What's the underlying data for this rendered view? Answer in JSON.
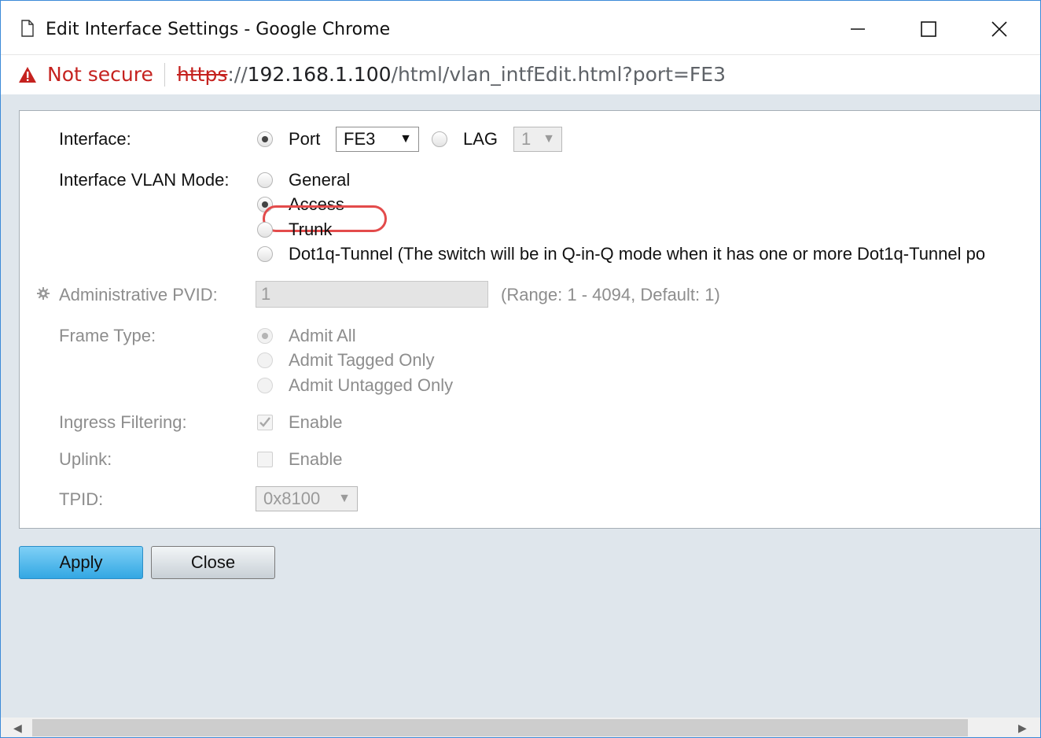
{
  "window": {
    "title": "Edit Interface Settings - Google Chrome",
    "icons": {
      "page": "page-icon",
      "minimize": "minimize-icon",
      "maximize": "maximize-icon",
      "close": "close-icon"
    }
  },
  "address": {
    "security_label": "Not secure",
    "url_scheme": "https",
    "url_sep": "://",
    "url_host": "192.168.1.100",
    "url_path": "/html/vlan_intfEdit.html?port=FE3",
    "warning_icon": "warning-icon"
  },
  "form": {
    "interface": {
      "label": "Interface:",
      "port_label": "Port",
      "port_value": "FE3",
      "lag_label": "LAG",
      "lag_value": "1",
      "selected": "port"
    },
    "vlan_mode": {
      "label": "Interface VLAN Mode:",
      "options": [
        {
          "label": "General",
          "checked": false
        },
        {
          "label": "Access",
          "checked": true
        },
        {
          "label": "Trunk",
          "checked": false
        },
        {
          "label": "Dot1q-Tunnel (The switch will be in Q-in-Q mode when it has one or more Dot1q-Tunnel po",
          "checked": false
        }
      ]
    },
    "pvid": {
      "label": "Administrative PVID:",
      "value": "1",
      "hint": "(Range: 1 - 4094, Default: 1)",
      "icon": "gear-icon"
    },
    "frame_type": {
      "label": "Frame Type:",
      "options": [
        {
          "label": "Admit All",
          "checked": true
        },
        {
          "label": "Admit Tagged Only",
          "checked": false
        },
        {
          "label": "Admit Untagged Only",
          "checked": false
        }
      ]
    },
    "ingress": {
      "label": "Ingress Filtering:",
      "option": "Enable",
      "checked": true
    },
    "uplink": {
      "label": "Uplink:",
      "option": "Enable",
      "checked": false
    },
    "tpid": {
      "label": "TPID:",
      "value": "0x8100"
    }
  },
  "buttons": {
    "apply": "Apply",
    "close": "Close"
  },
  "colors": {
    "accent": "#33a7e3",
    "warning": "#c5221f",
    "highlight": "#e34b4b"
  }
}
